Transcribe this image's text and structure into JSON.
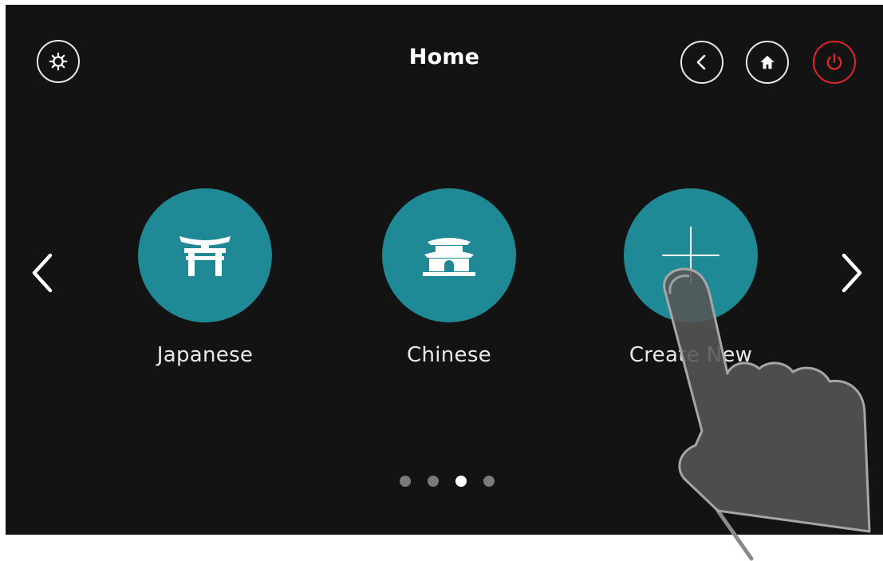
{
  "header": {
    "title": "Home",
    "buttons": [
      {
        "name": "settings",
        "icon": "gear-icon"
      },
      {
        "name": "back",
        "icon": "chevron-left-icon"
      },
      {
        "name": "home",
        "icon": "house-icon"
      },
      {
        "name": "power",
        "icon": "power-icon",
        "color": "#e0262b"
      }
    ]
  },
  "carousel": {
    "tiles": [
      {
        "label": "Japanese",
        "icon": "torii-gate-icon"
      },
      {
        "label": "Chinese",
        "icon": "chinese-gate-icon"
      },
      {
        "label": "Create New",
        "icon": "plus-icon"
      }
    ],
    "page_count": 4,
    "active_page": 3
  },
  "colors": {
    "background": "#131313",
    "tile_accent": "#1f8a96",
    "power_accent": "#e0262b"
  },
  "overlay": {
    "icon": "pointing-hand-icon"
  }
}
